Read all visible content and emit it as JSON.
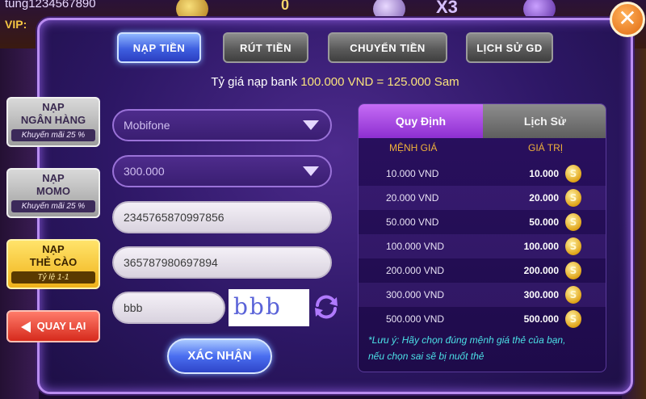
{
  "background": {
    "username": "tung1234567890",
    "vip_label": "VIP:",
    "balance": "0",
    "multiplier": "X3"
  },
  "close_label": "✕",
  "tabs": [
    {
      "label": "NẠP TIỀN",
      "active": true
    },
    {
      "label": "RÚT TIỀN",
      "active": false
    },
    {
      "label": "CHUYỂN TIỀN",
      "active": false
    },
    {
      "label": "LỊCH SỬ GD",
      "active": false
    }
  ],
  "rate": {
    "prefix": "Tỷ giá nạp bank",
    "value": "100.000 VND = 125.000 Sam"
  },
  "side_menu": [
    {
      "line1": "NẠP",
      "line2": "NGÂN HÀNG",
      "promo": "Khuyến mãi 25 %",
      "style": "gray"
    },
    {
      "line1": "NẠP",
      "line2": "MOMO",
      "promo": "Khuyến mãi 25 %",
      "style": "gray"
    },
    {
      "line1": "NẠP",
      "line2": "THẺ CÀO",
      "promo": "Tỷ lệ 1-1",
      "style": "gold"
    }
  ],
  "back_label": "QUAY LẠI",
  "form": {
    "carrier": "Mobifone",
    "amount": "300.000",
    "serial": "2345765870997856",
    "pin": "365787980697894",
    "captcha_value": "bbb",
    "captcha_image_text": "bbb",
    "submit_label": "XÁC NHẬN"
  },
  "panel": {
    "tab_rules": "Quy Định",
    "tab_history": "Lịch Sử",
    "col_denomination": "MỆNH GIÁ",
    "col_value": "GIÁ TRỊ",
    "rows": [
      {
        "denomination": "10.000 VND",
        "value": "10.000"
      },
      {
        "denomination": "20.000 VND",
        "value": "20.000"
      },
      {
        "denomination": "50.000 VND",
        "value": "50.000"
      },
      {
        "denomination": "100.000 VND",
        "value": "100.000"
      },
      {
        "denomination": "200.000 VND",
        "value": "200.000"
      },
      {
        "denomination": "300.000 VND",
        "value": "300.000"
      },
      {
        "denomination": "500.000 VND",
        "value": "500.000"
      }
    ],
    "coin_symbol": "S",
    "note_line1": "*Lưu ý: Hãy chọn đúng mệnh giá thẻ của bạn,",
    "note_line2": "nếu chọn sai sẽ bị nuốt thẻ"
  },
  "icons": {
    "close": "close-icon",
    "caret": "chevron-down-icon",
    "refresh": "refresh-icon",
    "back": "arrow-left-icon",
    "coin": "coin-icon"
  }
}
